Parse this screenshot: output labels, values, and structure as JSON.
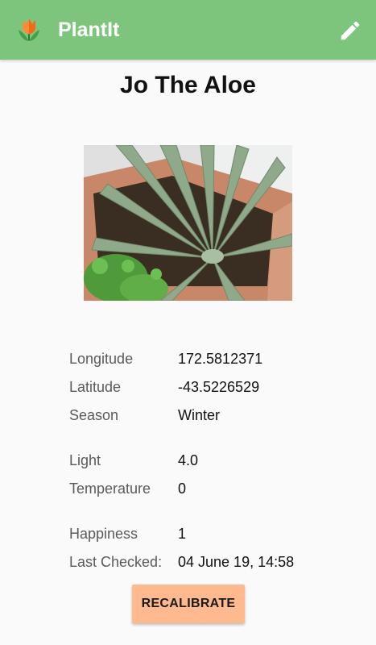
{
  "appbar": {
    "title": "PlantIt",
    "logo_icon": "tulip-icon",
    "edit_icon": "pencil-icon",
    "color": "#7dc47d"
  },
  "plant": {
    "name": "Jo The Aloe",
    "photo_icon": "aloe-plant-photo"
  },
  "location": {
    "longitude_label": "Longitude",
    "longitude_value": "172.5812371",
    "latitude_label": "Latitude",
    "latitude_value": "-43.5226529",
    "season_label": "Season",
    "season_value": "Winter"
  },
  "conditions": {
    "light_label": "Light",
    "light_value": "4.0",
    "temperature_label": "Temperature",
    "temperature_value": "0"
  },
  "status": {
    "happiness_label": "Happiness",
    "happiness_value": "1",
    "last_checked_label": "Last Checked:",
    "last_checked_value": "04 June 19, 14:58"
  },
  "actions": {
    "recalibrate_label": "RECALIBRATE",
    "button_color": "#ffb98f"
  }
}
